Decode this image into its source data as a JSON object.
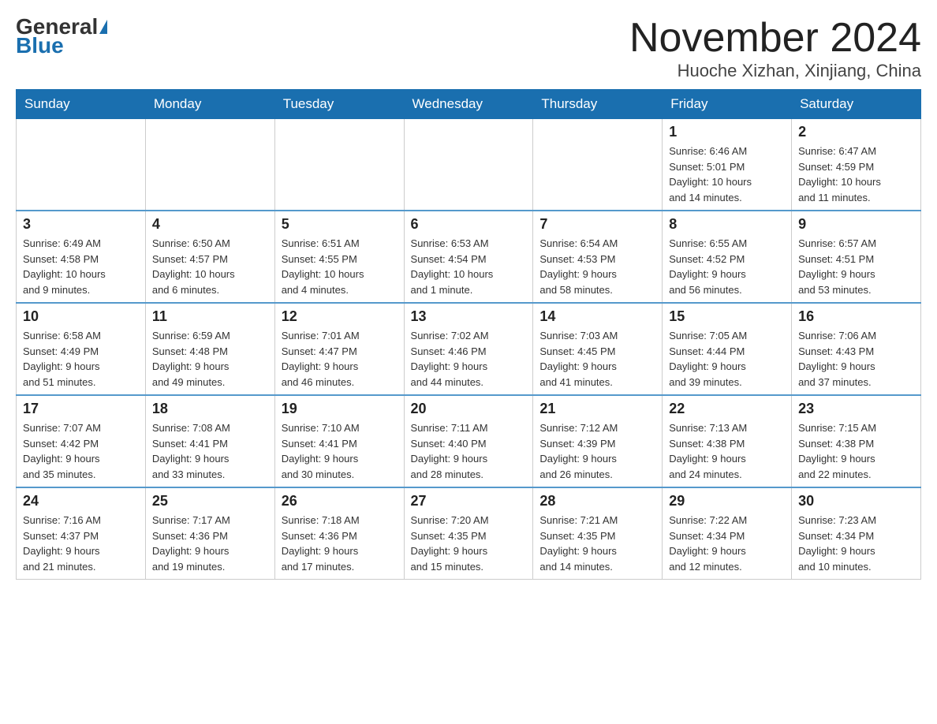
{
  "header": {
    "logo_general": "General",
    "logo_blue": "Blue",
    "month_title": "November 2024",
    "location": "Huoche Xizhan, Xinjiang, China"
  },
  "weekdays": [
    "Sunday",
    "Monday",
    "Tuesday",
    "Wednesday",
    "Thursday",
    "Friday",
    "Saturday"
  ],
  "weeks": [
    [
      {
        "day": "",
        "info": ""
      },
      {
        "day": "",
        "info": ""
      },
      {
        "day": "",
        "info": ""
      },
      {
        "day": "",
        "info": ""
      },
      {
        "day": "",
        "info": ""
      },
      {
        "day": "1",
        "info": "Sunrise: 6:46 AM\nSunset: 5:01 PM\nDaylight: 10 hours\nand 14 minutes."
      },
      {
        "day": "2",
        "info": "Sunrise: 6:47 AM\nSunset: 4:59 PM\nDaylight: 10 hours\nand 11 minutes."
      }
    ],
    [
      {
        "day": "3",
        "info": "Sunrise: 6:49 AM\nSunset: 4:58 PM\nDaylight: 10 hours\nand 9 minutes."
      },
      {
        "day": "4",
        "info": "Sunrise: 6:50 AM\nSunset: 4:57 PM\nDaylight: 10 hours\nand 6 minutes."
      },
      {
        "day": "5",
        "info": "Sunrise: 6:51 AM\nSunset: 4:55 PM\nDaylight: 10 hours\nand 4 minutes."
      },
      {
        "day": "6",
        "info": "Sunrise: 6:53 AM\nSunset: 4:54 PM\nDaylight: 10 hours\nand 1 minute."
      },
      {
        "day": "7",
        "info": "Sunrise: 6:54 AM\nSunset: 4:53 PM\nDaylight: 9 hours\nand 58 minutes."
      },
      {
        "day": "8",
        "info": "Sunrise: 6:55 AM\nSunset: 4:52 PM\nDaylight: 9 hours\nand 56 minutes."
      },
      {
        "day": "9",
        "info": "Sunrise: 6:57 AM\nSunset: 4:51 PM\nDaylight: 9 hours\nand 53 minutes."
      }
    ],
    [
      {
        "day": "10",
        "info": "Sunrise: 6:58 AM\nSunset: 4:49 PM\nDaylight: 9 hours\nand 51 minutes."
      },
      {
        "day": "11",
        "info": "Sunrise: 6:59 AM\nSunset: 4:48 PM\nDaylight: 9 hours\nand 49 minutes."
      },
      {
        "day": "12",
        "info": "Sunrise: 7:01 AM\nSunset: 4:47 PM\nDaylight: 9 hours\nand 46 minutes."
      },
      {
        "day": "13",
        "info": "Sunrise: 7:02 AM\nSunset: 4:46 PM\nDaylight: 9 hours\nand 44 minutes."
      },
      {
        "day": "14",
        "info": "Sunrise: 7:03 AM\nSunset: 4:45 PM\nDaylight: 9 hours\nand 41 minutes."
      },
      {
        "day": "15",
        "info": "Sunrise: 7:05 AM\nSunset: 4:44 PM\nDaylight: 9 hours\nand 39 minutes."
      },
      {
        "day": "16",
        "info": "Sunrise: 7:06 AM\nSunset: 4:43 PM\nDaylight: 9 hours\nand 37 minutes."
      }
    ],
    [
      {
        "day": "17",
        "info": "Sunrise: 7:07 AM\nSunset: 4:42 PM\nDaylight: 9 hours\nand 35 minutes."
      },
      {
        "day": "18",
        "info": "Sunrise: 7:08 AM\nSunset: 4:41 PM\nDaylight: 9 hours\nand 33 minutes."
      },
      {
        "day": "19",
        "info": "Sunrise: 7:10 AM\nSunset: 4:41 PM\nDaylight: 9 hours\nand 30 minutes."
      },
      {
        "day": "20",
        "info": "Sunrise: 7:11 AM\nSunset: 4:40 PM\nDaylight: 9 hours\nand 28 minutes."
      },
      {
        "day": "21",
        "info": "Sunrise: 7:12 AM\nSunset: 4:39 PM\nDaylight: 9 hours\nand 26 minutes."
      },
      {
        "day": "22",
        "info": "Sunrise: 7:13 AM\nSunset: 4:38 PM\nDaylight: 9 hours\nand 24 minutes."
      },
      {
        "day": "23",
        "info": "Sunrise: 7:15 AM\nSunset: 4:38 PM\nDaylight: 9 hours\nand 22 minutes."
      }
    ],
    [
      {
        "day": "24",
        "info": "Sunrise: 7:16 AM\nSunset: 4:37 PM\nDaylight: 9 hours\nand 21 minutes."
      },
      {
        "day": "25",
        "info": "Sunrise: 7:17 AM\nSunset: 4:36 PM\nDaylight: 9 hours\nand 19 minutes."
      },
      {
        "day": "26",
        "info": "Sunrise: 7:18 AM\nSunset: 4:36 PM\nDaylight: 9 hours\nand 17 minutes."
      },
      {
        "day": "27",
        "info": "Sunrise: 7:20 AM\nSunset: 4:35 PM\nDaylight: 9 hours\nand 15 minutes."
      },
      {
        "day": "28",
        "info": "Sunrise: 7:21 AM\nSunset: 4:35 PM\nDaylight: 9 hours\nand 14 minutes."
      },
      {
        "day": "29",
        "info": "Sunrise: 7:22 AM\nSunset: 4:34 PM\nDaylight: 9 hours\nand 12 minutes."
      },
      {
        "day": "30",
        "info": "Sunrise: 7:23 AM\nSunset: 4:34 PM\nDaylight: 9 hours\nand 10 minutes."
      }
    ]
  ]
}
